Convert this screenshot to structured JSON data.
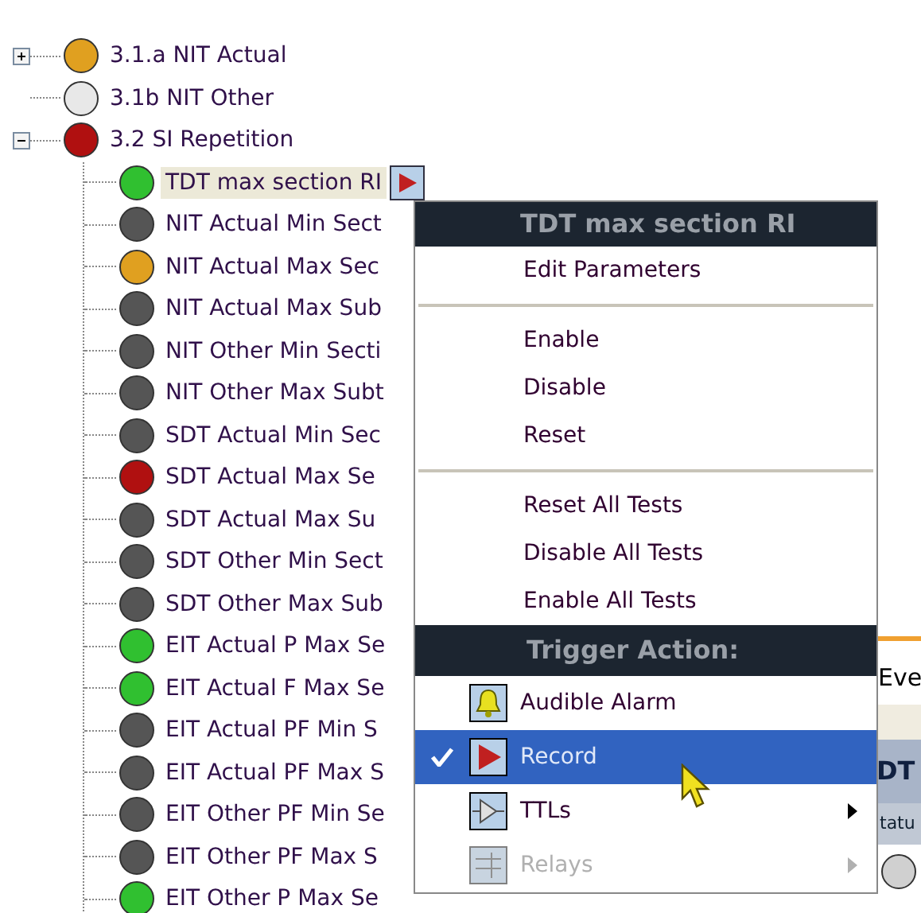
{
  "tree": [
    {
      "label": "3.1.a NIT Actual",
      "color": "#e0a020",
      "expanded": false,
      "selected": false
    },
    {
      "label": "3.1b NIT Other",
      "color": "#e8e8e8",
      "selected": false
    },
    {
      "label": "3.2 SI Repetition",
      "color": "#b01010",
      "expanded": true,
      "selected": false,
      "children": [
        {
          "label": "TDT max section RI",
          "color": "#30c030",
          "selected": true,
          "record_button": true
        },
        {
          "label": "NIT Actual Min Sect",
          "color": "#555555",
          "selected": false
        },
        {
          "label": "NIT Actual Max Sec",
          "color": "#e0a020",
          "selected": false
        },
        {
          "label": "NIT Actual Max Sub",
          "color": "#555555",
          "selected": false
        },
        {
          "label": "NIT Other Min Secti",
          "color": "#555555",
          "selected": false
        },
        {
          "label": "NIT Other Max Subt",
          "color": "#555555",
          "selected": false
        },
        {
          "label": "SDT Actual Min Sec",
          "color": "#555555",
          "selected": false
        },
        {
          "label": "SDT Actual Max Se",
          "color": "#b01010",
          "selected": false
        },
        {
          "label": "SDT Actual Max Su",
          "color": "#555555",
          "selected": false
        },
        {
          "label": "SDT Other Min Sect",
          "color": "#555555",
          "selected": false
        },
        {
          "label": "SDT Other Max Sub",
          "color": "#555555",
          "selected": false
        },
        {
          "label": "EIT Actual P Max Se",
          "color": "#30c030",
          "selected": false
        },
        {
          "label": "EIT Actual F Max Se",
          "color": "#30c030",
          "selected": false
        },
        {
          "label": "EIT Actual PF Min S",
          "color": "#555555",
          "selected": false
        },
        {
          "label": "EIT Actual PF Max S",
          "color": "#555555",
          "selected": false
        },
        {
          "label": "EIT Other PF Min Se",
          "color": "#555555",
          "selected": false
        },
        {
          "label": "EIT Other PF Max S",
          "color": "#555555",
          "selected": false
        },
        {
          "label": "EIT Other P Max Se",
          "color": "#30c030",
          "selected": false
        }
      ]
    }
  ],
  "context_menu": {
    "title": "TDT max section RI",
    "items": [
      {
        "kind": "item",
        "label": "Edit Parameters"
      },
      {
        "kind": "separator"
      },
      {
        "kind": "item",
        "label": "Enable"
      },
      {
        "kind": "item",
        "label": "Disable"
      },
      {
        "kind": "item",
        "label": "Reset"
      },
      {
        "kind": "separator"
      },
      {
        "kind": "item",
        "label": "Reset All Tests"
      },
      {
        "kind": "item",
        "label": "Disable All Tests"
      },
      {
        "kind": "item",
        "label": "Enable All Tests"
      },
      {
        "kind": "header",
        "label": "Trigger Action:"
      },
      {
        "kind": "action",
        "label": "Audible Alarm",
        "selected": false,
        "checked": false,
        "submenu": false,
        "disabled": false
      },
      {
        "kind": "action",
        "label": "Record",
        "selected": true,
        "checked": true,
        "submenu": false,
        "disabled": false
      },
      {
        "kind": "action",
        "label": "TTLs",
        "selected": false,
        "checked": false,
        "submenu": true,
        "disabled": false
      },
      {
        "kind": "action",
        "label": "Relays",
        "selected": false,
        "checked": false,
        "submenu": true,
        "disabled": true
      }
    ]
  },
  "background_panel": {
    "tab": "Eve",
    "heading": "DT",
    "column": "tatu"
  }
}
